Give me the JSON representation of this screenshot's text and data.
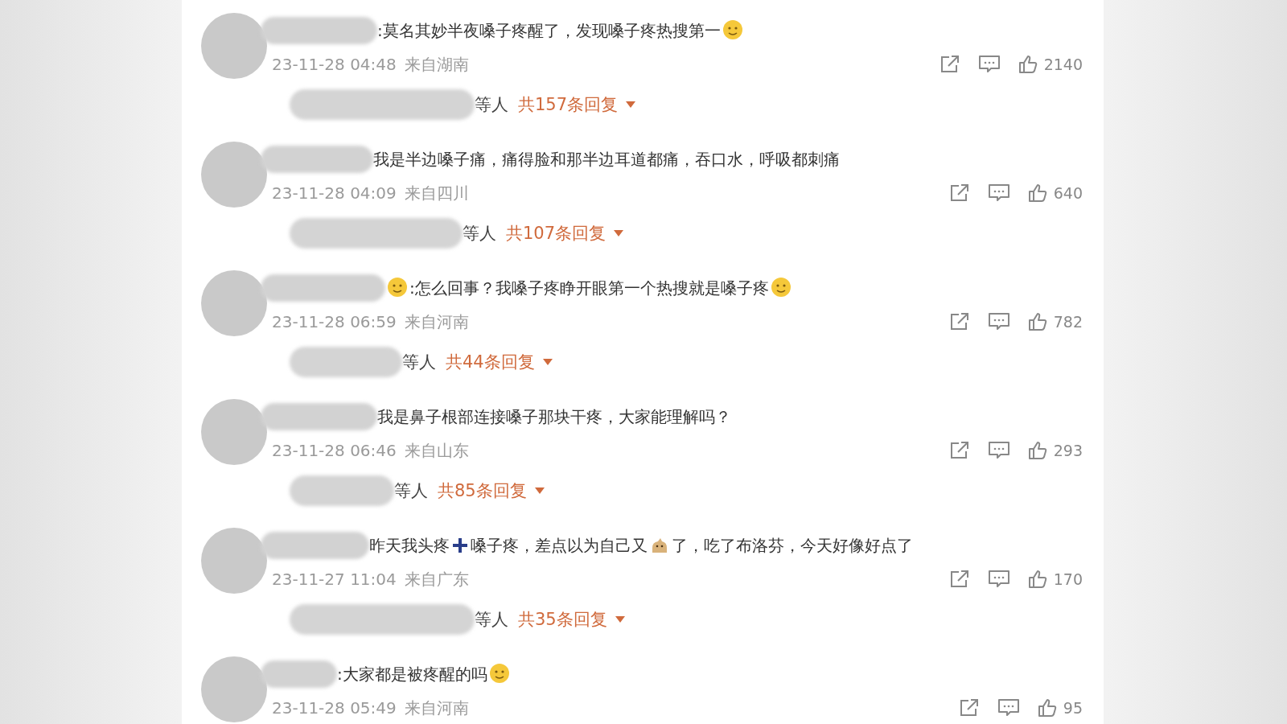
{
  "comments": [
    {
      "parts": [
        {
          "kind": "text",
          "text": ":莫名其妙半夜嗓子疼醒了，发现嗓子疼热搜第一"
        },
        {
          "kind": "emoji"
        }
      ],
      "time": "23-11-28 04:48",
      "location": "来自湖南",
      "likes": "2140",
      "reply": {
        "suffix": "等人",
        "count": "共157条回复"
      }
    },
    {
      "parts": [
        {
          "kind": "text",
          "text": "我是半边嗓子痛，痛得脸和那半边耳道都痛，吞口水，呼吸都刺痛"
        }
      ],
      "time": "23-11-28 04:09",
      "location": "来自四川",
      "likes": "640",
      "reply": {
        "suffix": "等人",
        "count": "共107条回复"
      }
    },
    {
      "parts": [
        {
          "kind": "emoji"
        },
        {
          "kind": "text",
          "text": ":怎么回事？我嗓子疼睁开眼第一个热搜就是嗓子疼"
        },
        {
          "kind": "emoji"
        }
      ],
      "time": "23-11-28 06:59",
      "location": "来自河南",
      "likes": "782",
      "reply": {
        "suffix": "等人",
        "count": "共44条回复"
      }
    },
    {
      "parts": [
        {
          "kind": "text",
          "text": "我是鼻子根部连接嗓子那块干疼，大家能理解吗？"
        }
      ],
      "time": "23-11-28 06:46",
      "location": "来自山东",
      "likes": "293",
      "reply": {
        "suffix": "等人",
        "count": "共85条回复"
      }
    },
    {
      "parts": [
        {
          "kind": "text",
          "text": "昨天我头疼"
        },
        {
          "kind": "plus"
        },
        {
          "kind": "text",
          "text": "嗓子疼，差点以为自己又"
        },
        {
          "kind": "dog"
        },
        {
          "kind": "text",
          "text": "了，吃了布洛芬，今天好像好点了"
        }
      ],
      "time": "23-11-27 11:04",
      "location": "来自广东",
      "likes": "170",
      "reply": {
        "suffix": "等人",
        "count": "共35条回复"
      }
    },
    {
      "parts": [
        {
          "kind": "text",
          "text": ":大家都是被疼醒的吗"
        },
        {
          "kind": "emoji"
        }
      ],
      "time": "23-11-28 05:49",
      "location": "来自河南",
      "likes": "95"
    }
  ]
}
